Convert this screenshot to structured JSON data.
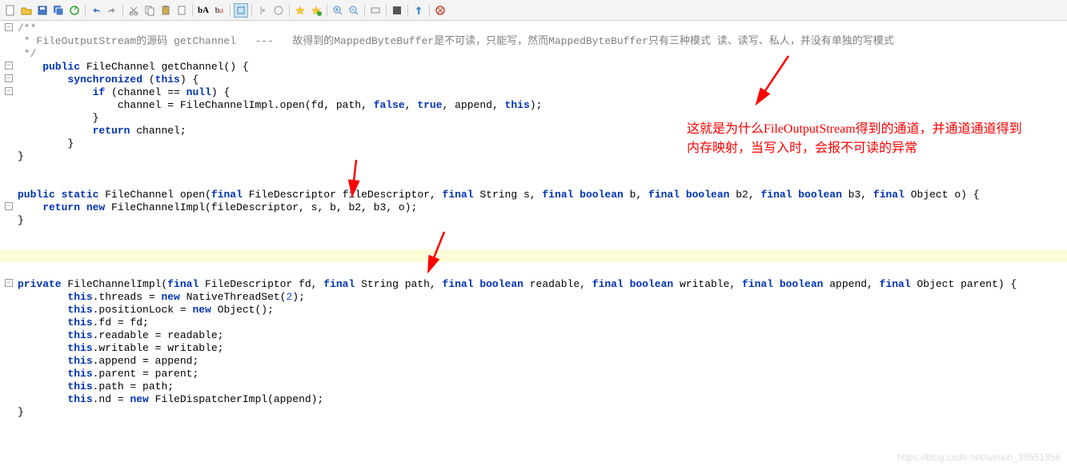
{
  "toolbar": {
    "icons": [
      "new-file",
      "open",
      "save",
      "save-all",
      "sync",
      "undo",
      "redo",
      "cut",
      "copy",
      "paste",
      "clipboard",
      "search",
      "replace",
      "highlight",
      "nav-back",
      "nav-fwd",
      "star",
      "star-add",
      "zoom-in",
      "zoom-out",
      "fit",
      "fullscreen",
      "pin",
      "stop"
    ]
  },
  "code": {
    "l1": "/**",
    "l2": " * FileOutputStream的源码 getChannel   ---   故得到的MappedByteBuffer是不可读，只能写，然而MappedByteBuffer只有三种模式 读、读写、私人，并没有单独的写模式",
    "l3": " */",
    "l4a": "    public",
    "l4b": " FileChannel ",
    "l4c": "getChannel",
    "l4d": "() {",
    "l5a": "        synchronized",
    "l5b": " (",
    "l5c": "this",
    "l5d": ") {",
    "l6a": "            if",
    "l6b": " (channel == ",
    "l6c": "null",
    "l6d": ") {",
    "l7a": "                channel = FileChannelImpl.open(fd, path, ",
    "l7b": "false",
    "l7c": ", ",
    "l7d": "true",
    "l7e": ", append, ",
    "l7f": "this",
    "l7g": ");",
    "l8": "            }",
    "l9a": "            return",
    "l9b": " channel;",
    "l10": "        }",
    "l11": "}",
    "l13a": "public static",
    "l13b": " FileChannel ",
    "l13c": "open",
    "l13d": "(",
    "l13e": "final",
    "l13f": " FileDescriptor fileDescriptor, ",
    "l13g": "final",
    "l13h": " String s, ",
    "l13i": "final boolean",
    "l13j": " b, ",
    "l13k": "final boolean",
    "l13l": " b2, ",
    "l13m": "final boolean",
    "l13n": " b3, ",
    "l13o": "final",
    "l13p": " Object o) {",
    "l14a": "    return new",
    "l14b": " FileChannelImpl(fileDescriptor, s, b, b2, b3, o);",
    "l15": "}",
    "l18a": "private",
    "l18b": " FileChannelImpl(",
    "l18c": "final",
    "l18d": " FileDescriptor fd, ",
    "l18e": "final",
    "l18f": " String path, ",
    "l18g": "final boolean",
    "l18h": " readable, ",
    "l18i": "final boolean",
    "l18j": " writable, ",
    "l18k": "final boolean",
    "l18l": " append, ",
    "l18m": "final",
    "l18n": " Object parent) {",
    "l19a": "        this",
    "l19b": ".threads = ",
    "l19c": "new",
    "l19d": " NativeThreadSet(",
    "l19e": "2",
    "l19f": ");",
    "l20a": "        this",
    "l20b": ".positionLock = ",
    "l20c": "new",
    "l20d": " Object();",
    "l21a": "        this",
    "l21b": ".fd = fd;",
    "l22a": "        this",
    "l22b": ".readable = readable;",
    "l23a": "        this",
    "l23b": ".writable = writable;",
    "l24a": "        this",
    "l24b": ".append = append;",
    "l25a": "        this",
    "l25b": ".parent = parent;",
    "l26a": "        this",
    "l26b": ".path = path;",
    "l27a": "        this",
    "l27b": ".nd = ",
    "l27c": "new",
    "l27d": " FileDispatcherImpl(append);",
    "l28": "}"
  },
  "annotation": {
    "text": "这就是为什么FileOutputStream得到的通道，并通道通道得到内存映射，当写入时，会报不可读的异常"
  },
  "watermark": "https://blog.csdn.net/weixin_39651356"
}
